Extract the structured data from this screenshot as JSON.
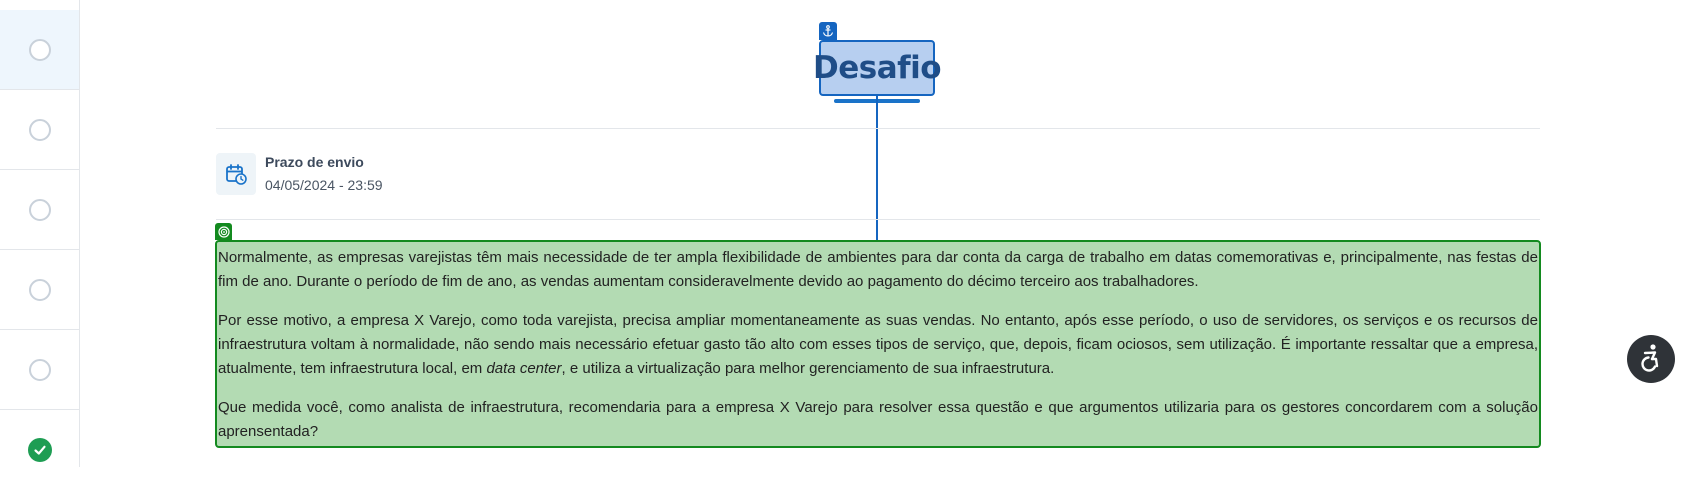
{
  "steps": [
    {
      "state": "active"
    },
    {
      "state": "pending"
    },
    {
      "state": "pending"
    },
    {
      "state": "pending"
    },
    {
      "state": "pending"
    },
    {
      "state": "done"
    }
  ],
  "title": "Desafio",
  "deadline": {
    "label": "Prazo de envio",
    "value": "04/05/2024 - 23:59"
  },
  "content": {
    "p1": "Normalmente, as empresas varejistas têm mais necessidade de ter ampla flexibilidade de ambientes para dar conta da carga de trabalho em datas comemorativas e, principalmente, nas festas de fim de ano. Durante o período de fim de ano, as vendas aumentam consideravelmente devido ao pagamento do décimo terceiro aos trabalhadores.",
    "p2_before": "Por esse motivo, a empresa X Varejo, como toda varejista, precisa ampliar momentaneamente as suas vendas. No entanto, após esse período, o uso de servidores, os serviços e os recursos de infraestrutura voltam à normalidade, não sendo mais necessário efetuar gasto tão alto com esses tipos de serviço, que, depois, ficam ociosos, sem utilização. É importante ressaltar que a empresa, atualmente, tem infraestrutura local, em ",
    "p2_emph": "data center",
    "p2_after": ", e utiliza a virtualização para melhor gerenciamento de sua infraestrutura.",
    "p3": "Que medida você, como analista de infraestrutura, recomendaria para a empresa X Varejo para resolver essa questão e que argumentos utilizaria para os gestores concordarem com a solução aprensentada?"
  },
  "colors": {
    "accent": "#1565c0",
    "done": "#1e9d53",
    "highlight": "#b3dbb3",
    "highlight_border": "#138a1f"
  },
  "icons": {
    "title_marker": "anchor-icon",
    "content_marker": "target-icon",
    "deadline": "calendar-clock-icon",
    "floating": "accessibility-icon"
  }
}
